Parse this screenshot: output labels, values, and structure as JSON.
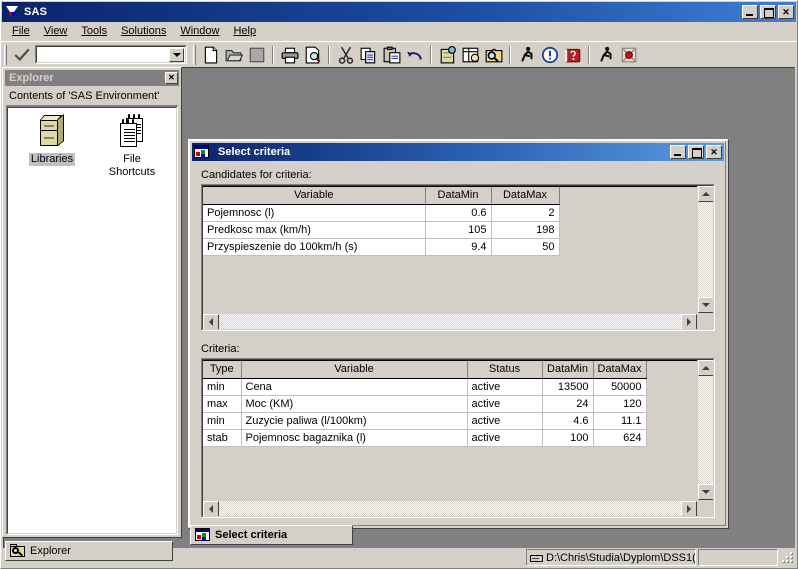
{
  "app": {
    "title": "SAS",
    "logo_icon": "sas-logo-icon",
    "window_controls": {
      "minimize": "_",
      "maximize": "□",
      "close": "✕"
    }
  },
  "menubar": {
    "items": [
      {
        "label": "File",
        "accel": "F"
      },
      {
        "label": "View",
        "accel": "V"
      },
      {
        "label": "Tools",
        "accel": "T"
      },
      {
        "label": "Solutions",
        "accel": "S"
      },
      {
        "label": "Window",
        "accel": "W"
      },
      {
        "label": "Help",
        "accel": "H"
      }
    ]
  },
  "command_bar": {
    "submit_icon": "checkmark-icon",
    "value": "",
    "placeholder": "",
    "dropdown_icon": "chevron-down-icon"
  },
  "toolbar": {
    "buttons": [
      {
        "name": "new-icon",
        "tip": "New"
      },
      {
        "name": "open-icon",
        "tip": "Open"
      },
      {
        "name": "save-icon",
        "tip": "Save"
      },
      {
        "name": "print-icon",
        "tip": "Print"
      },
      {
        "name": "print-preview-icon",
        "tip": "Print Preview"
      },
      {
        "name": "cut-icon",
        "tip": "Cut"
      },
      {
        "name": "copy-icon",
        "tip": "Copy"
      },
      {
        "name": "paste-icon",
        "tip": "Paste"
      },
      {
        "name": "undo-icon",
        "tip": "Undo"
      },
      {
        "name": "new-library-icon",
        "tip": "New Library"
      },
      {
        "name": "viewtable-icon",
        "tip": "View Table"
      },
      {
        "name": "explorer-icon",
        "tip": "Explorer"
      },
      {
        "name": "run-icon",
        "tip": "Submit"
      },
      {
        "name": "break-icon",
        "tip": "Break"
      },
      {
        "name": "help-icon",
        "tip": "Help"
      },
      {
        "name": "run2-icon",
        "tip": "Run"
      },
      {
        "name": "stop-icon",
        "tip": "Stop"
      }
    ]
  },
  "explorer": {
    "title": "Explorer",
    "close_icon": "close-icon",
    "contents_header": "Contents of 'SAS Environment'",
    "items": [
      {
        "label": "Libraries",
        "icon": "library-cabinet-icon",
        "selected": true
      },
      {
        "label": "File\nShortcuts",
        "label_line1": "File",
        "label_line2": "Shortcuts",
        "icon": "file-shortcuts-icon",
        "selected": false
      }
    ],
    "taskbar_label": "Explorer",
    "taskbar_icon": "explorer-magnifier-icon"
  },
  "select_criteria": {
    "title": "Select criteria",
    "title_icon": "sas-table-icon",
    "window_controls": {
      "minimize": "_",
      "maximize": "□",
      "close": "✕"
    },
    "candidates_label": "Candidates for criteria:",
    "candidates_table": {
      "columns": [
        "Variable",
        "DataMin",
        "DataMax"
      ],
      "rows": [
        [
          "Pojemnosc (l)",
          "0.6",
          "2"
        ],
        [
          "Predkosc max (km/h)",
          "105",
          "198"
        ],
        [
          "Przyspieszenie do 100km/h (s)",
          "9.4",
          "50"
        ]
      ]
    },
    "criteria_label": "Criteria:",
    "criteria_table": {
      "columns": [
        "Type",
        "Variable",
        "Status",
        "DataMin",
        "DataMax"
      ],
      "rows": [
        [
          "min",
          "Cena",
          "active",
          "13500",
          "50000"
        ],
        [
          "max",
          "Moc (KM)",
          "active",
          "24",
          "120"
        ],
        [
          "min",
          "Zuzycie paliwa (l/100km)",
          "active",
          "4.6",
          "11.1"
        ],
        [
          "stab",
          "Pojemnosc bagaznika (l)",
          "active",
          "100",
          "624"
        ]
      ]
    },
    "taskbar_label": "Select criteria",
    "taskbar_icon": "sas-table-icon"
  },
  "statusbar": {
    "left_text": "",
    "path": "D:\\Chris\\Studia\\Dyplom\\DSS1(",
    "path_icon": "drive-icon",
    "extra": "",
    "resize_grip": "resize-grip-icon"
  },
  "colors": {
    "titlebar_active_start": "#0a246a",
    "titlebar_active_end": "#3f7fd4",
    "face": "#d4d0c8",
    "mdi_background": "#808080",
    "grid_cell": "#ffffff",
    "selection": "#c0c0c0"
  }
}
